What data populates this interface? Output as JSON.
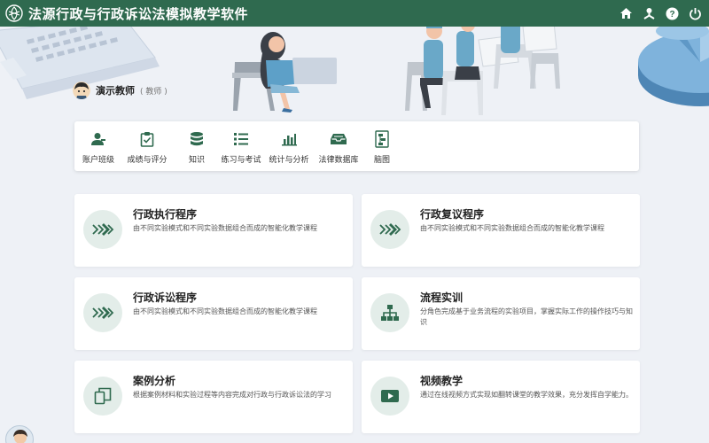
{
  "app": {
    "title": "法源行政与行政诉讼法模拟教学软件"
  },
  "topbar_icons": [
    "home-icon",
    "user-structure-icon",
    "help-icon",
    "power-icon"
  ],
  "user": {
    "name": "演示教师",
    "role": "( 教师 )"
  },
  "nav": [
    {
      "label": "账户班级",
      "icon": "users-icon"
    },
    {
      "label": "成绩与评分",
      "icon": "clipboard-check-icon"
    },
    {
      "label": "知识",
      "icon": "database-icon"
    },
    {
      "label": "练习与考试",
      "icon": "list-icon"
    },
    {
      "label": "统计与分析",
      "icon": "bar-chart-icon"
    },
    {
      "label": "法律数据库",
      "icon": "inbox-tray-icon"
    },
    {
      "label": "脑图",
      "icon": "mindmap-icon"
    }
  ],
  "cards": [
    {
      "title": "行政执行程序",
      "desc": "由不同实验模式和不同实验数据组合而成的智能化教学课程",
      "icon": "double-chevron-icon"
    },
    {
      "title": "行政复议程序",
      "desc": "由不同实验模式和不同实验数据组合而成的智能化教学课程",
      "icon": "double-chevron-icon"
    },
    {
      "title": "行政诉讼程序",
      "desc": "由不同实验模式和不同实验数据组合而成的智能化教学课程",
      "icon": "double-chevron-icon"
    },
    {
      "title": "流程实训",
      "desc": "分角色完成基于业务流程的实验项目，掌握实际工作的操作技巧与知识",
      "icon": "flowchart-icon"
    },
    {
      "title": "案例分析",
      "desc": "根据案例材料和实验过程等内容完成对行政与行政诉讼法的学习",
      "icon": "copy-documents-icon"
    },
    {
      "title": "视频教学",
      "desc": "通过在线视频方式实现如翻转课堂的教学效果，充分发挥自学能力。",
      "icon": "video-play-icon"
    }
  ],
  "colors": {
    "topbar": "#2f6a4f",
    "accent": "#2f6a4f",
    "icon_circle": "#e3ede9",
    "background": "#eef1f6"
  }
}
